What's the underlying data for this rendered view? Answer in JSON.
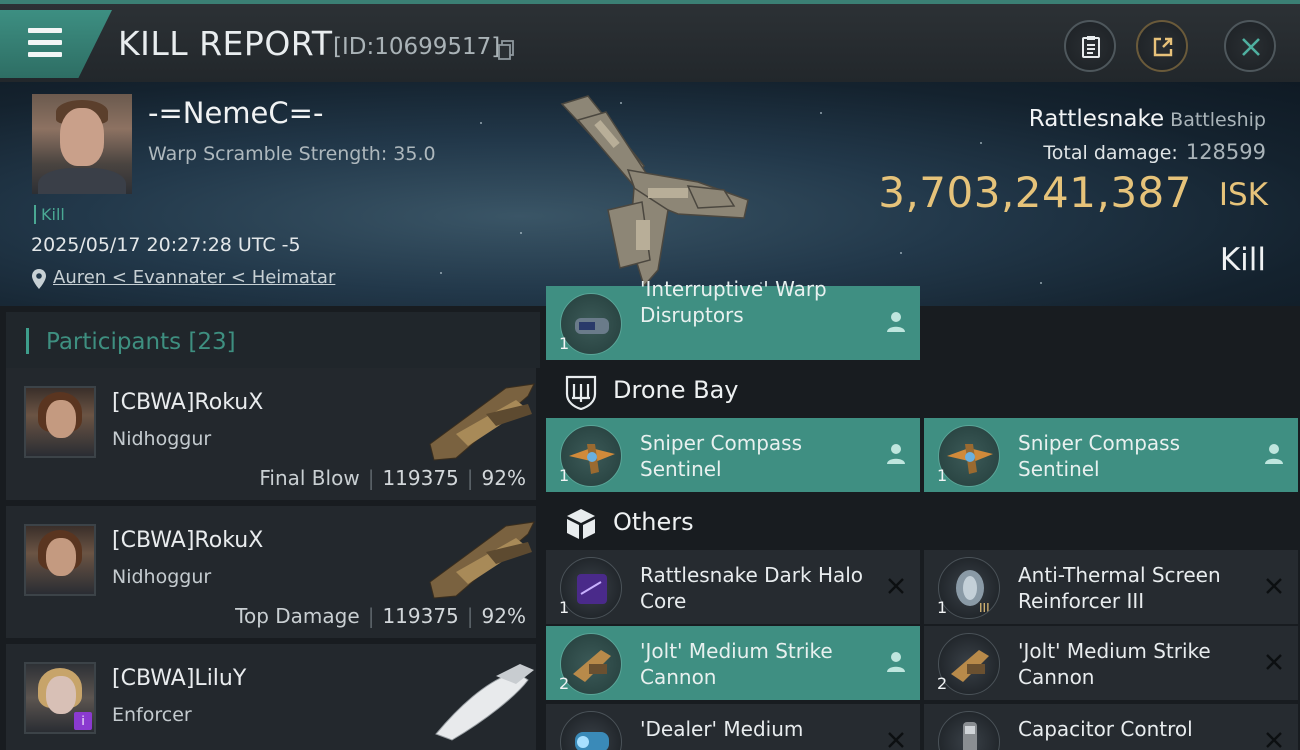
{
  "topbar": {
    "title": "KILL REPORT",
    "report_id": "[ID:10699517]"
  },
  "victim": {
    "pilot_name": "-=NemeC=-",
    "warp_scramble": "Warp Scramble Strength: 35.0",
    "kill_tag": "Kill",
    "timestamp": "2025/05/17 20:27:28 UTC -5",
    "location": "Auren < Evannater < Heimatar",
    "ship_name": "Rattlesnake",
    "ship_class": "Battleship",
    "total_damage_label": "Total damage:",
    "total_damage": "128599",
    "isk_value": "3,703,241,387",
    "isk_unit": "ISK",
    "result": "Kill"
  },
  "participants": {
    "header": "Participants [23]",
    "items": [
      {
        "name": "[CBWA]RokuX",
        "ship": "Nidhoggur",
        "role": "Final Blow",
        "damage": "119375",
        "percent": "92%"
      },
      {
        "name": "[CBWA]RokuX",
        "ship": "Nidhoggur",
        "role": "Top Damage",
        "damage": "119375",
        "percent": "92%"
      },
      {
        "name": "[CBWA]LiluY",
        "ship": "Enforcer",
        "role": "",
        "damage": "",
        "percent": ""
      }
    ]
  },
  "modules": {
    "clipped_item": {
      "name": "'Interruptive' Warp Disruptors",
      "qty": "1",
      "state": "fitted"
    },
    "drone_bay": {
      "title": "Drone Bay",
      "items": [
        {
          "name": "Sniper Compass Sentinel",
          "qty": "1",
          "state": "fitted"
        },
        {
          "name": "Sniper Compass Sentinel",
          "qty": "1",
          "state": "fitted"
        }
      ]
    },
    "others": {
      "title": "Others",
      "items": [
        {
          "name": "Rattlesnake Dark Halo Core",
          "qty": "1",
          "state": "destroyed"
        },
        {
          "name": "Anti-Thermal Screen Reinforcer III",
          "qty": "1",
          "state": "destroyed"
        },
        {
          "name": "'Jolt' Medium Strike Cannon",
          "qty": "2",
          "state": "fitted"
        },
        {
          "name": "'Jolt' Medium Strike Cannon",
          "qty": "2",
          "state": "destroyed"
        },
        {
          "name": "'Dealer' Medium",
          "qty": "",
          "state": "destroyed"
        },
        {
          "name": "Capacitor Control",
          "qty": "",
          "state": "destroyed"
        }
      ]
    }
  },
  "icons": {
    "menu": "hamburger-icon",
    "copy": "copy-icon",
    "clipboard": "clipboard-icon",
    "share": "share-icon",
    "close": "close-icon",
    "location": "location-pin-icon",
    "drone": "drone-bay-icon",
    "others": "cargo-box-icon",
    "dropped": "person-icon",
    "destroyed": "x-icon"
  },
  "colors": {
    "accent": "#3e9e8c",
    "fitted_item": "#3f8f82",
    "isk_gold": "#e6c37a"
  }
}
